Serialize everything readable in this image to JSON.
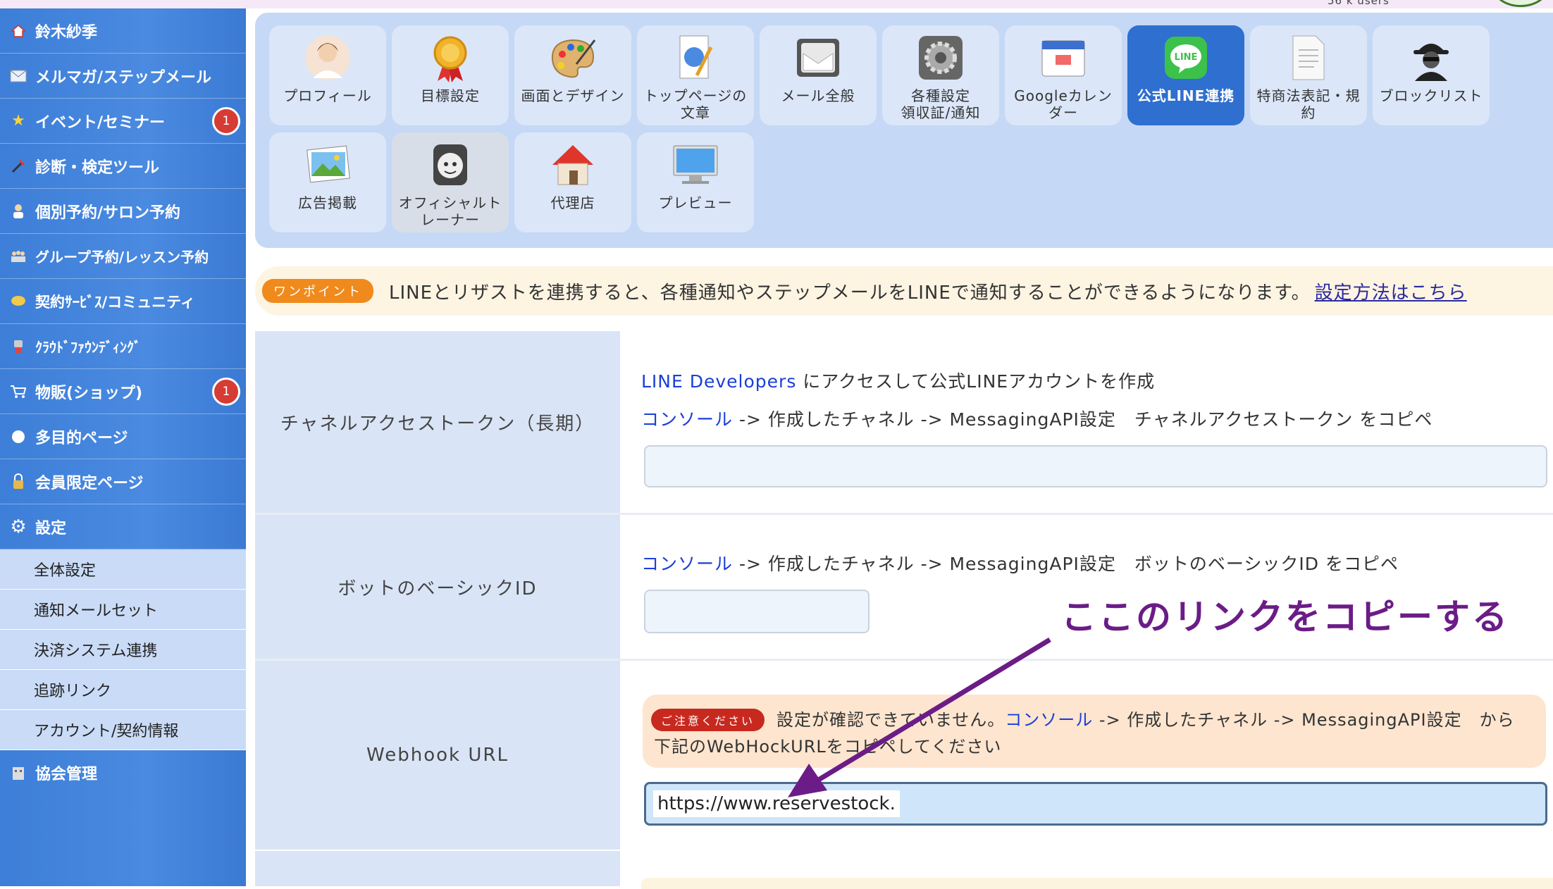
{
  "top": {
    "users": "56 k users"
  },
  "sidebar": {
    "items": [
      {
        "label": "鈴木紗季",
        "icon": "home-icon"
      },
      {
        "label": "メルマガ/ステップメール",
        "icon": "mail-icon"
      },
      {
        "label": "イベント/セミナー",
        "icon": "star-icon",
        "badge": "1"
      },
      {
        "label": "診断・検定ツール",
        "icon": "tools-icon"
      },
      {
        "label": "個別予約/サロン予約",
        "icon": "person-icon"
      },
      {
        "label": "グループ予約/レッスン予約",
        "icon": "group-icon"
      },
      {
        "label": "契約ｻｰﾋﾞｽ/コミュニティ",
        "icon": "bulb-icon"
      },
      {
        "label": "ｸﾗｳﾄﾞﾌｧｳﾝﾃﾞｨﾝｸﾞ",
        "icon": "robot-icon"
      },
      {
        "label": "物販(ショップ)",
        "icon": "cart-icon",
        "badge": "1"
      },
      {
        "label": "多目的ページ",
        "icon": "circle-icon"
      },
      {
        "label": "会員限定ページ",
        "icon": "lock-icon"
      },
      {
        "label": "設定",
        "icon": "gear-icon"
      }
    ],
    "subitems": [
      "全体設定",
      "通知メールセット",
      "決済システム連携",
      "追跡リンク",
      "アカウント/契約情報"
    ],
    "last": {
      "label": "協会管理",
      "icon": "building-icon"
    }
  },
  "tiles": [
    {
      "label": "プロフィール",
      "icon": "profile-photo-icon"
    },
    {
      "label": "目標設定",
      "icon": "medal-icon"
    },
    {
      "label": "画面とデザイン",
      "icon": "palette-icon"
    },
    {
      "label": "トップページの\n文章",
      "icon": "document-pen-icon"
    },
    {
      "label": "メール全般",
      "icon": "envelope-icon"
    },
    {
      "label": "各種設定\n領収証/通知",
      "icon": "gear-icon"
    },
    {
      "label": "Googleカレン\nダー",
      "icon": "calendar-icon"
    },
    {
      "label": "公式LINE連携",
      "icon": "line-icon",
      "active": true
    },
    {
      "label": "特商法表記・規\n約",
      "icon": "paper-icon"
    },
    {
      "label": "ブロックリスト",
      "icon": "spy-icon"
    },
    {
      "label": "広告掲載",
      "icon": "picture-icon"
    },
    {
      "label": "オフィシャルト\nレーナー",
      "icon": "trainer-icon",
      "dim": true
    },
    {
      "label": "代理店",
      "icon": "house-icon"
    },
    {
      "label": "プレビュー",
      "icon": "monitor-icon"
    }
  ],
  "onepoint": {
    "badge": "ワンポイント",
    "text": "LINEとリザストを連携すると、各種通知やステップメールをLINEで通知することができるようになります。",
    "link": "設定方法はこちら"
  },
  "token_row": {
    "label": "チャネルアクセストークン（長期）",
    "line1_link": "LINE Developers",
    "line1_text": " にアクセスして公式LINEアカウントを作成",
    "line2_link": "コンソール",
    "line2_text": " -> 作成したチャネル -> MessagingAPI設定　チャネルアクセストークン をコピペ",
    "value": ""
  },
  "botid_row": {
    "label": "ボットのベーシックID",
    "line_link": "コンソール",
    "line_text": " -> 作成したチャネル -> MessagingAPI設定　ボットのベーシックID をコピペ",
    "value": ""
  },
  "webhook_row": {
    "label": "Webhook URL",
    "warn_badge": "ご注意ください",
    "warn_text1": "設定が確認できていません。",
    "warn_link": "コンソール",
    "warn_text2": " -> 作成したチャネル -> MessagingAPI設定　から",
    "warn_line2": "下記のWebHockURLをコピペしてください",
    "value": "https://www.reservestock."
  },
  "annotation": "ここのリンクをコピーする",
  "colors": {
    "accent": "#2f6fd0",
    "annotation": "#6b1c86",
    "warning": "#c8291f",
    "onepoint": "#f08a1c"
  }
}
